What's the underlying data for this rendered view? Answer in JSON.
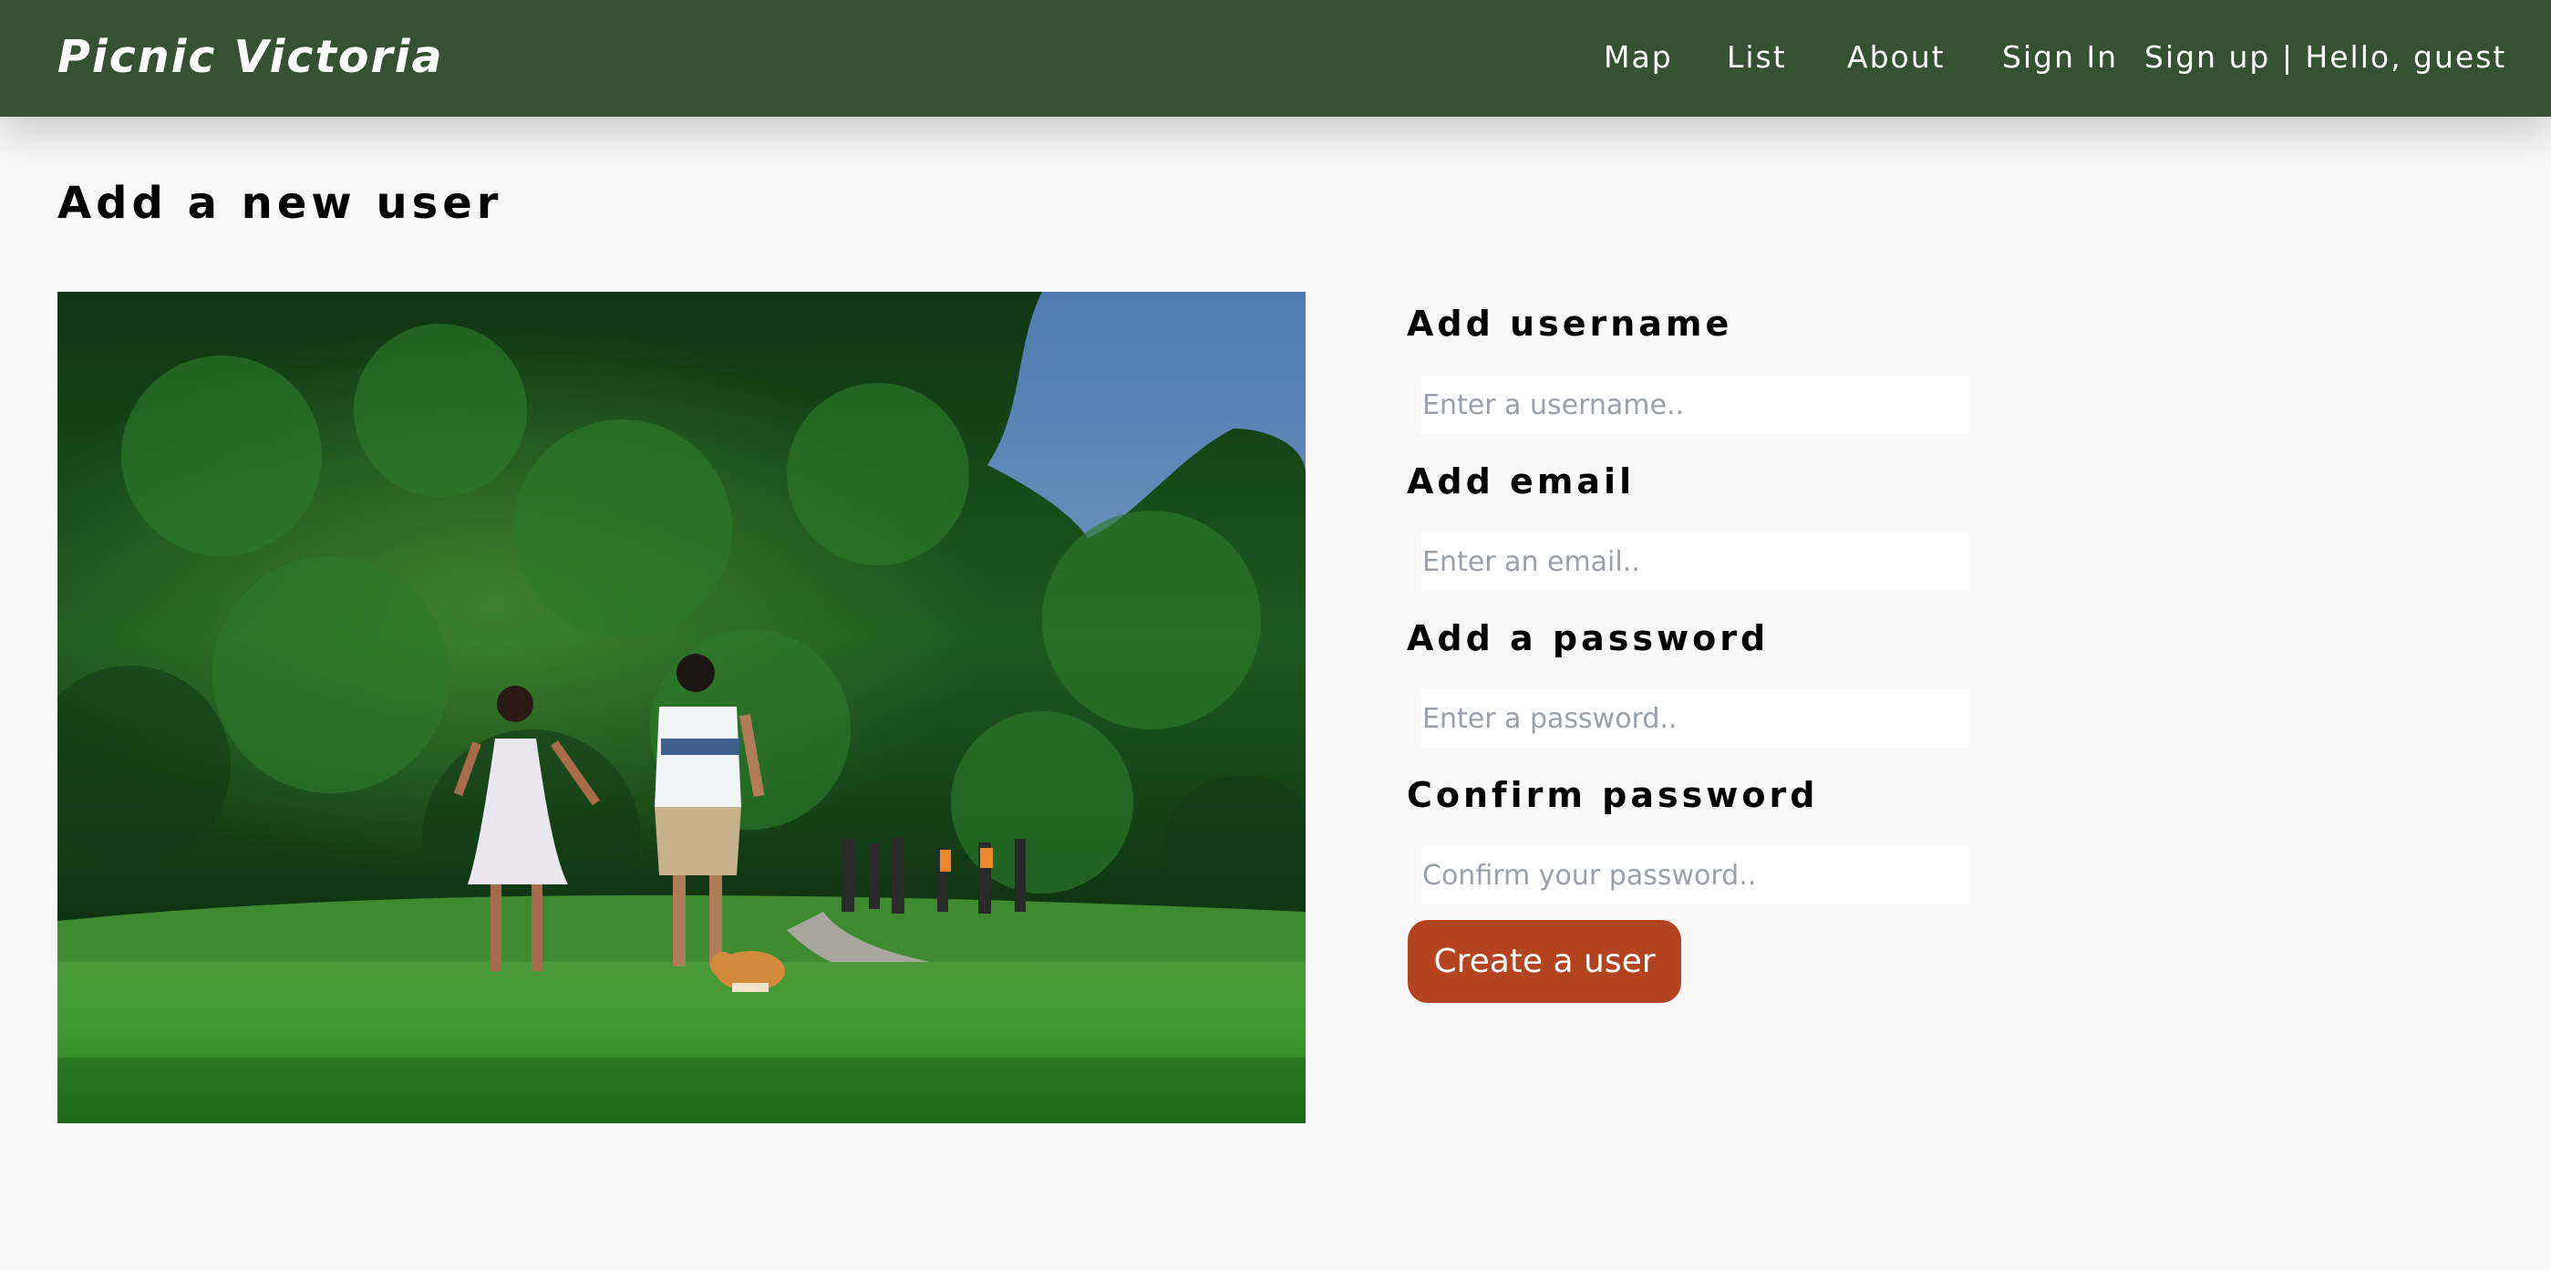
{
  "header": {
    "brand": "Picnic Victoria",
    "nav": {
      "map": "Map",
      "list": "List",
      "about": "About",
      "sign_in": "Sign In",
      "sign_up_greeting": "Sign up | Hello, guest"
    }
  },
  "page": {
    "title": "Add a new user"
  },
  "form": {
    "username_label": "Add username",
    "username_placeholder": "Enter a username..",
    "email_label": "Add email",
    "email_placeholder": "Enter an email..",
    "password_label": "Add a password",
    "password_placeholder": "Enter a password..",
    "confirm_label": "Confirm password",
    "confirm_placeholder": "Confirm your password..",
    "submit_label": "Create a user"
  },
  "colors": {
    "navbar": "#345231",
    "background": "#f7f7f7",
    "button": "#b3441f"
  }
}
